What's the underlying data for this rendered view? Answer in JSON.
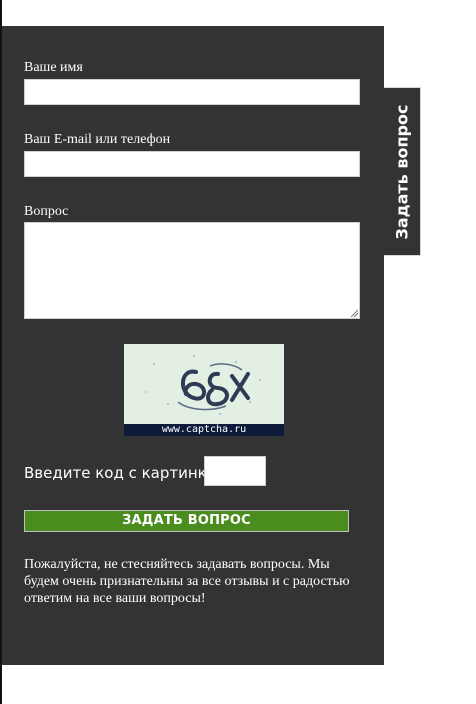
{
  "form": {
    "name_label": "Ваше имя",
    "name_value": "",
    "contact_label": "Ваш E-mail или телефон",
    "contact_value": "",
    "question_label": "Вопрос",
    "question_value": "",
    "captcha_site": "www.captcha.ru",
    "captcha_text": "68X",
    "code_label": "Введите код с картинки:",
    "code_value": "",
    "submit_label": "ЗАДАТЬ ВОПРОС",
    "notice": "Пожалуйста, не стесняйтесь задавать вопросы. Мы будем очень признательны за все отзывы и с радостью ответим на все ваши вопросы!"
  },
  "side_tab": {
    "label": "Задать вопрос"
  },
  "colors": {
    "panel": "#333333",
    "submit": "#4a8d1e",
    "captcha_bg": "#e3efe3",
    "captcha_footer": "#0d1a3a"
  }
}
